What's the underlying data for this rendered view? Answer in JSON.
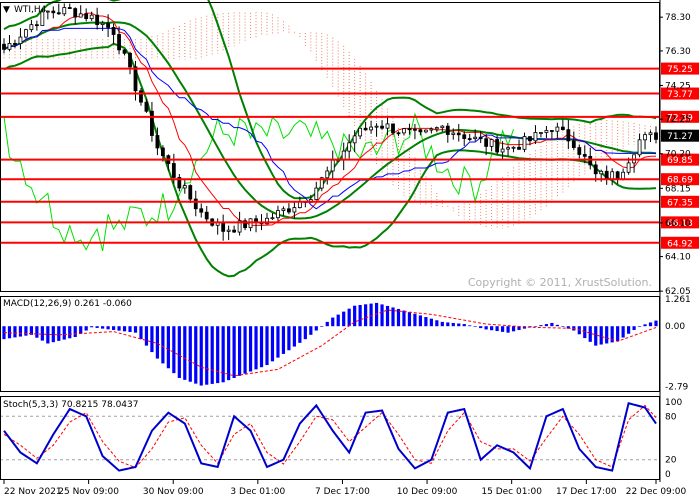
{
  "chart_data": {
    "type": "candlestick",
    "symbol_title": "WTI,H4",
    "watermark": "Copyright © 2011, XrustSolution.",
    "price_panel": {
      "ylim": [
        62.0,
        79.2
      ],
      "ticks": [
        "78.30",
        "76.30",
        "74.25",
        "72.25",
        "70.20",
        "68.15",
        "66.10",
        "64.10",
        "62.05"
      ],
      "tick_values": [
        78.3,
        76.3,
        74.25,
        72.25,
        70.2,
        68.15,
        66.1,
        64.1,
        62.05
      ],
      "levels": [
        {
          "label": "75.25",
          "value": 75.25
        },
        {
          "label": "73.77",
          "value": 73.77
        },
        {
          "label": "72.39",
          "value": 72.39
        },
        {
          "label": "69.85",
          "value": 69.85
        },
        {
          "label": "68.69",
          "value": 68.69
        },
        {
          "label": "67.35",
          "value": 67.35
        },
        {
          "label": "66.13",
          "value": 66.13
        },
        {
          "label": "64.92",
          "value": 64.92
        }
      ],
      "current_price": {
        "label": "71.27",
        "value": 71.27
      },
      "bar_count": 120,
      "close_path": [
        [
          0,
          76.4
        ],
        [
          4,
          77.6
        ],
        [
          8,
          78.6
        ],
        [
          12,
          78.7
        ],
        [
          16,
          78.3
        ],
        [
          20,
          77.5
        ],
        [
          24,
          74.2
        ],
        [
          28,
          70.6
        ],
        [
          32,
          68.4
        ],
        [
          36,
          66.7
        ],
        [
          40,
          65.7
        ],
        [
          44,
          66.0
        ],
        [
          48,
          66.3
        ],
        [
          52,
          67.0
        ],
        [
          56,
          67.8
        ],
        [
          60,
          69.5
        ],
        [
          64,
          71.3
        ],
        [
          68,
          72.0
        ],
        [
          72,
          71.6
        ],
        [
          76,
          71.2
        ],
        [
          80,
          71.8
        ],
        [
          84,
          71.3
        ],
        [
          88,
          70.8
        ],
        [
          92,
          70.5
        ],
        [
          96,
          71.0
        ],
        [
          100,
          71.8
        ],
        [
          104,
          70.9
        ],
        [
          108,
          68.9
        ],
        [
          112,
          68.9
        ],
        [
          116,
          71.0
        ],
        [
          119,
          71.3
        ]
      ]
    },
    "macd_panel": {
      "label": "MACD(12,26,9) 0.261 -0.060",
      "ylim": [
        -3.05,
        1.4
      ],
      "ticks": [
        "1.261",
        "0.00",
        "-2.79"
      ],
      "tick_values": [
        1.261,
        0.0,
        -2.79
      ],
      "hist_path": [
        [
          0,
          -0.6
        ],
        [
          5,
          -0.4
        ],
        [
          8,
          -0.8
        ],
        [
          13,
          -0.5
        ],
        [
          16,
          -0.05
        ],
        [
          24,
          -0.3
        ],
        [
          28,
          -1.5
        ],
        [
          32,
          -2.4
        ],
        [
          36,
          -2.75
        ],
        [
          40,
          -2.6
        ],
        [
          48,
          -1.8
        ],
        [
          55,
          -0.6
        ],
        [
          60,
          0.4
        ],
        [
          64,
          0.95
        ],
        [
          68,
          1.08
        ],
        [
          72,
          0.8
        ],
        [
          76,
          0.5
        ],
        [
          80,
          0.2
        ],
        [
          84,
          0.1
        ],
        [
          88,
          -0.15
        ],
        [
          92,
          -0.3
        ],
        [
          96,
          -0.05
        ],
        [
          100,
          0.15
        ],
        [
          104,
          -0.2
        ],
        [
          108,
          -0.9
        ],
        [
          112,
          -0.7
        ],
        [
          116,
          0.0
        ],
        [
          119,
          0.26
        ]
      ],
      "signal_path": [
        [
          0,
          -0.3
        ],
        [
          10,
          -0.4
        ],
        [
          20,
          -0.25
        ],
        [
          28,
          -0.8
        ],
        [
          36,
          -1.9
        ],
        [
          42,
          -2.3
        ],
        [
          50,
          -2.0
        ],
        [
          58,
          -0.9
        ],
        [
          64,
          0.2
        ],
        [
          70,
          0.75
        ],
        [
          78,
          0.55
        ],
        [
          88,
          0.1
        ],
        [
          96,
          -0.05
        ],
        [
          104,
          -0.1
        ],
        [
          112,
          -0.7
        ],
        [
          119,
          -0.06
        ]
      ]
    },
    "stoch_panel": {
      "label": "Stoch(5,3,3) 70.8215 78.0437",
      "ylim": [
        -8,
        108
      ],
      "ticks": [
        "100",
        "80",
        "20",
        "0"
      ],
      "tick_values": [
        100,
        80,
        20,
        0
      ],
      "main_path": [
        [
          0,
          60
        ],
        [
          3,
          30
        ],
        [
          6,
          15
        ],
        [
          9,
          55
        ],
        [
          12,
          90
        ],
        [
          15,
          80
        ],
        [
          18,
          25
        ],
        [
          21,
          5
        ],
        [
          24,
          10
        ],
        [
          27,
          60
        ],
        [
          30,
          85
        ],
        [
          33,
          70
        ],
        [
          36,
          15
        ],
        [
          39,
          10
        ],
        [
          42,
          80
        ],
        [
          45,
          60
        ],
        [
          48,
          10
        ],
        [
          51,
          20
        ],
        [
          54,
          70
        ],
        [
          57,
          95
        ],
        [
          60,
          60
        ],
        [
          63,
          30
        ],
        [
          66,
          85
        ],
        [
          69,
          88
        ],
        [
          72,
          35
        ],
        [
          75,
          8
        ],
        [
          78,
          20
        ],
        [
          81,
          85
        ],
        [
          84,
          90
        ],
        [
          87,
          20
        ],
        [
          90,
          40
        ],
        [
          93,
          30
        ],
        [
          96,
          8
        ],
        [
          99,
          80
        ],
        [
          102,
          90
        ],
        [
          105,
          35
        ],
        [
          108,
          10
        ],
        [
          111,
          5
        ],
        [
          114,
          98
        ],
        [
          117,
          92
        ],
        [
          119,
          70
        ]
      ],
      "signal_path": [
        [
          0,
          55
        ],
        [
          3,
          40
        ],
        [
          6,
          22
        ],
        [
          9,
          40
        ],
        [
          12,
          72
        ],
        [
          15,
          85
        ],
        [
          18,
          45
        ],
        [
          21,
          18
        ],
        [
          24,
          9
        ],
        [
          27,
          35
        ],
        [
          30,
          72
        ],
        [
          33,
          78
        ],
        [
          36,
          40
        ],
        [
          39,
          15
        ],
        [
          42,
          55
        ],
        [
          45,
          70
        ],
        [
          48,
          30
        ],
        [
          51,
          14
        ],
        [
          54,
          45
        ],
        [
          57,
          80
        ],
        [
          60,
          75
        ],
        [
          63,
          45
        ],
        [
          66,
          65
        ],
        [
          69,
          85
        ],
        [
          72,
          55
        ],
        [
          75,
          20
        ],
        [
          78,
          15
        ],
        [
          81,
          60
        ],
        [
          84,
          85
        ],
        [
          87,
          45
        ],
        [
          90,
          35
        ],
        [
          93,
          35
        ],
        [
          96,
          18
        ],
        [
          99,
          50
        ],
        [
          102,
          80
        ],
        [
          105,
          55
        ],
        [
          108,
          20
        ],
        [
          111,
          10
        ],
        [
          114,
          75
        ],
        [
          117,
          95
        ],
        [
          119,
          78
        ]
      ]
    },
    "x_labels": [
      "22 Nov 2021",
      "25 Nov 09:00",
      "30 Nov 09:00",
      "3 Dec 01:00",
      "7 Dec 17:00",
      "10 Dec 09:00",
      "15 Dec 01:00",
      "17 Dec 17:00",
      "22 Dec 09:00"
    ],
    "x_label_bars": [
      0,
      17,
      34,
      51,
      68,
      85,
      102,
      117,
      131
    ],
    "colors": {
      "level": "#ff0000",
      "level_tag": "#ff0000",
      "price_tag": "#000000",
      "candle": "#000000",
      "bollinger": "#008000",
      "tenkan": "#ff0000",
      "kijun": "#0000ff",
      "chikou": "#00e000",
      "cloud": "#f08060",
      "macd_hist": "#0000ff",
      "macd_signal": "#ff0000",
      "stoch_main": "#0000cc",
      "stoch_signal": "#ff0000"
    }
  }
}
